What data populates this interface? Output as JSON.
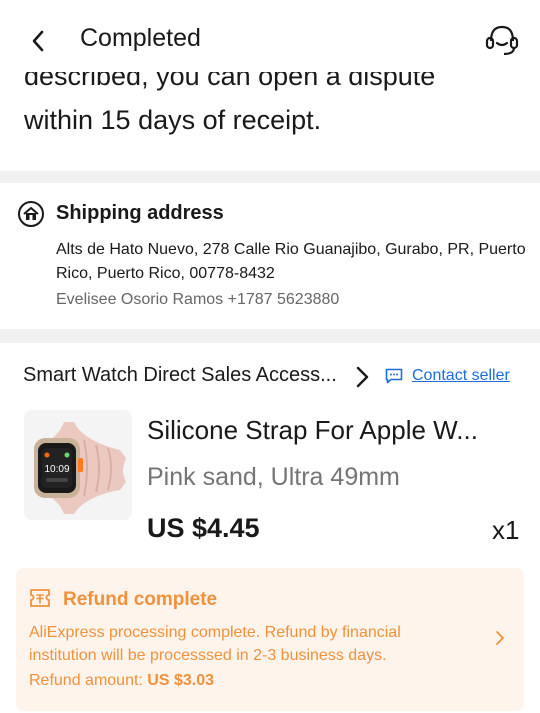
{
  "header": {
    "title": "Completed",
    "back_icon": "chevron-left-icon",
    "support_icon": "headset-icon"
  },
  "notice": {
    "cut_line": "described, you can open a dispute",
    "line": "within 15 days of receipt."
  },
  "shipping": {
    "title": "Shipping address",
    "icon": "home-icon",
    "address": "Alts de Hato Nuevo, 278 Calle Rio Guanajibo, Gurabo, PR, Puerto Rico, Puerto Rico, 00778-8432",
    "contact": "Evelisee Osorio Ramos +1787 5623880"
  },
  "store": {
    "name": "Smart Watch Direct Sales Access...",
    "contact_label": "Contact seller",
    "contact_icon": "chat-icon"
  },
  "item": {
    "title": "Silicone Strap For Apple W...",
    "variant": "Pink sand, Ultra 49mm",
    "price": "US $4.45",
    "quantity": "x1",
    "watch_time": "10:09"
  },
  "refund": {
    "title": "Refund complete",
    "icon": "receipt-icon",
    "description": "AliExpress processing complete. Refund by financial institution will be processsed in 2-3 business days.",
    "amount_label": "Refund amount:",
    "amount_value": "US $3.03"
  },
  "colors": {
    "accent": "#f0913c",
    "refund_bg": "#fff4eb",
    "link": "#1a6ddb",
    "separator": "#f2f2f2"
  }
}
